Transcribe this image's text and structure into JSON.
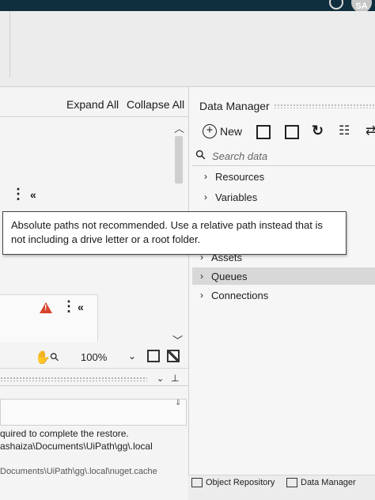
{
  "user": {
    "initials": "SA"
  },
  "designer": {
    "expand_all": "Expand All",
    "collapse_all": "Collapse All"
  },
  "zoom": {
    "value": "100%"
  },
  "output": {
    "lines": [
      "quired to complete the restore.",
      "ashaiza\\Documents\\UiPath\\gg\\.local",
      "Documents\\UiPath\\gg\\.local\\nuget.cache"
    ]
  },
  "data_manager": {
    "title": "Data Manager",
    "new_label": "New",
    "search_placeholder": "Search data",
    "tree": [
      {
        "label": "Resources"
      },
      {
        "label": "Variables"
      },
      {
        "label": "Assets"
      },
      {
        "label": "Queues",
        "selected": true
      },
      {
        "label": "Connections"
      }
    ]
  },
  "tooltip": {
    "text": "Absolute paths not recommended. Use a relative path instead that is not including a drive letter or a root folder."
  },
  "bottom_tabs": [
    {
      "label": "Object Repository"
    },
    {
      "label": "Data Manager"
    }
  ],
  "icons": {
    "warning": "warning-icon",
    "hand": "hand-tool-icon",
    "zoom": "magnifier-icon",
    "refresh": "refresh-icon"
  },
  "colors": {
    "title_bar": "#0f2f3f",
    "warning": "#d6442c",
    "selected_row": "#d8d8d8"
  }
}
